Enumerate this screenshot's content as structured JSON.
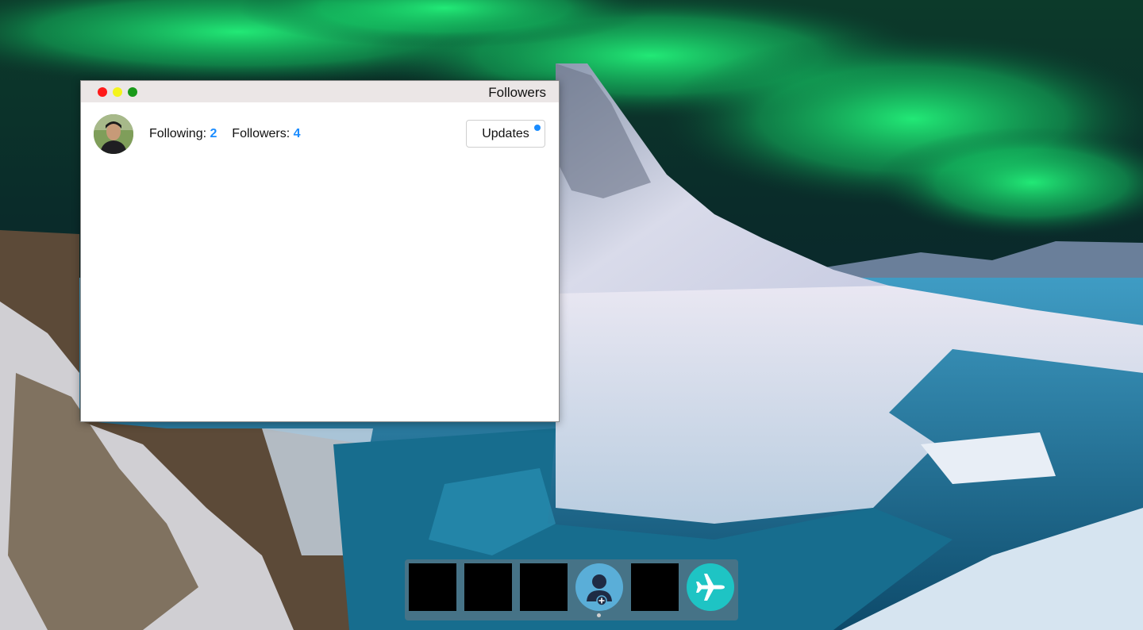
{
  "window": {
    "title": "Followers",
    "following_label": "Following:",
    "following_count": "2",
    "followers_label": "Followers:",
    "followers_count": "4",
    "updates_button": "Updates",
    "accent_color": "#1a8cff"
  },
  "dock": {
    "items": [
      {
        "icon": "app-placeholder"
      },
      {
        "icon": "app-placeholder"
      },
      {
        "icon": "app-placeholder"
      },
      {
        "icon": "add-user-icon",
        "running": true
      },
      {
        "icon": "app-placeholder"
      },
      {
        "icon": "airplane-icon"
      }
    ]
  },
  "traffic_lights": {
    "close": "#ff1a1a",
    "minimize": "#f4f41c",
    "maximize": "#1a9a1a"
  }
}
